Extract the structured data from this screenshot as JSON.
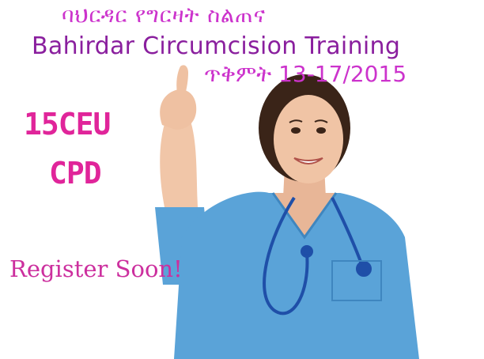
{
  "poster": {
    "amharic_heading": "ባህርዳር የግርዛት ስልጠና",
    "title": "Bahirdar Circumcision Training",
    "date_line": "ጥቅምት 13-17/2015",
    "ceu": "15CEU",
    "cpd": "CPD",
    "register": "Register Soon!"
  },
  "colors": {
    "amharic_text": "#cc33cc",
    "title_text": "#8a1f9e",
    "accent_pink": "#e0259a",
    "scrubs_blue": "#5aa3d8",
    "stethoscope": "#1f4fa8"
  }
}
